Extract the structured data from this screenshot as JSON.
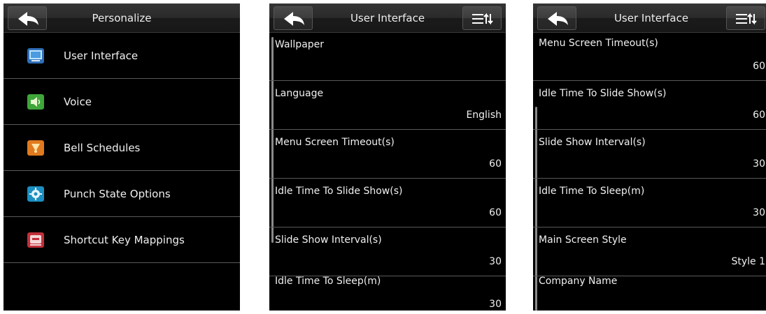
{
  "icons": {
    "back": "back-arrow-icon",
    "sort": "list-sort-icon",
    "user_interface": "monitor-icon",
    "voice": "speaker-icon",
    "bell": "bell-icon",
    "punch_state": "gear-icon",
    "shortcut": "keyboard-key-icon"
  },
  "colors": {
    "screen_bg": "#000000",
    "divider": "#5a5a5a",
    "text": "#f0f0f0"
  },
  "personalize": {
    "title": "Personalize",
    "items": [
      {
        "label": "User Interface",
        "icon": "monitor-icon"
      },
      {
        "label": "Voice",
        "icon": "speaker-icon"
      },
      {
        "label": "Bell Schedules",
        "icon": "bell-icon"
      },
      {
        "label": "Punch State Options",
        "icon": "gear-icon"
      },
      {
        "label": "Shortcut Key Mappings",
        "icon": "keyboard-key-icon"
      }
    ]
  },
  "ui_top": {
    "title": "User Interface",
    "rows": [
      {
        "label": "Wallpaper",
        "value": ""
      },
      {
        "label": "Language",
        "value": "English"
      },
      {
        "label": "Menu Screen Timeout(s)",
        "value": "60"
      },
      {
        "label": "Idle Time To Slide Show(s)",
        "value": "60"
      },
      {
        "label": "Slide Show Interval(s)",
        "value": "30"
      },
      {
        "label": "Idle Time To Sleep(m)",
        "value": "30"
      }
    ]
  },
  "ui_bottom": {
    "title": "User Interface",
    "rows": [
      {
        "label": "Menu Screen Timeout(s)",
        "value": "60"
      },
      {
        "label": "Idle Time To Slide Show(s)",
        "value": "60"
      },
      {
        "label": "Slide Show Interval(s)",
        "value": "30"
      },
      {
        "label": "Idle Time To Sleep(m)",
        "value": "30"
      },
      {
        "label": "Main Screen Style",
        "value": "Style 1"
      },
      {
        "label": "Company Name",
        "value": ""
      }
    ]
  }
}
